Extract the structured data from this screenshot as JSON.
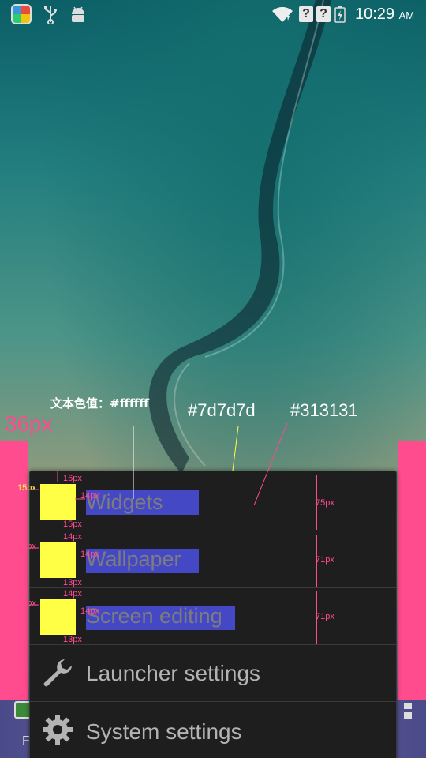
{
  "status_bar": {
    "icons": [
      "app-store-icon",
      "usb-icon",
      "android-debug-icon",
      "wifi-icon",
      "sim-unknown-icon",
      "sim-unknown-icon",
      "battery-charging-icon"
    ],
    "q1": "?",
    "q2": "?",
    "time": "10:29",
    "ampm": "AM"
  },
  "annotations": {
    "text_color_note": "文本色值：#ffffff",
    "color_item_bg": "#7d7d7d",
    "color_menu_bg": "#313131",
    "margin_36": "36px"
  },
  "menu": {
    "items": [
      {
        "label": "Widgets",
        "icon": "placeholder-yellow",
        "height_label": "75px"
      },
      {
        "label": "Wallpaper",
        "icon": "placeholder-yellow",
        "height_label": "71px"
      },
      {
        "label": "Screen editing",
        "icon": "placeholder-yellow",
        "height_label": "71px"
      },
      {
        "label": "Launcher settings",
        "icon": "wrench-icon"
      },
      {
        "label": "System settings",
        "icon": "gear-icon"
      }
    ]
  },
  "measure": {
    "m16": "16px",
    "m15": "15px",
    "m14": "14px",
    "m13": "13px"
  },
  "dock": {
    "letter": "F"
  },
  "colors": {
    "accent_pink": "#ff4c8f",
    "placeholder_yellow": "#ffff46",
    "label_highlight": "#4548c4",
    "menu_bg": "#1e1e1e"
  }
}
